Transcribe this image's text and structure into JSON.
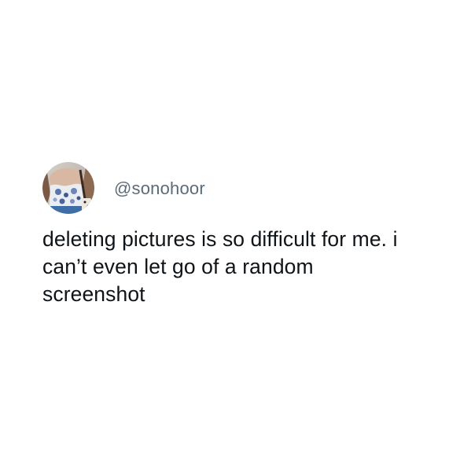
{
  "tweet": {
    "author": {
      "handle": "@sonohoor",
      "avatar_icon": "profile-photo-avatar"
    },
    "text_lines": [
      "deleting pictures is so difficult for me. i",
      "can’t even let go of a random",
      "screenshot"
    ]
  },
  "colors": {
    "background": "#ffffff",
    "handle": "#5b6b78",
    "text": "#0f1419"
  }
}
